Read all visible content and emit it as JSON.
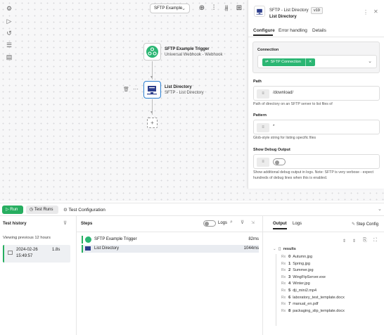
{
  "canvas": {
    "workflow_select": "SFTP Example",
    "node_trigger": {
      "title": "SFTP Example Trigger",
      "subtitle": "Universal Webhook - Webhook"
    },
    "node_list": {
      "title": "List Directory",
      "subtitle": "SFTP - List Directory"
    },
    "add_symbol": "+"
  },
  "panel": {
    "header_title": "SFTP - List Directory",
    "version": "v19",
    "name": "List Directory",
    "tabs": [
      "Configure",
      "Error handling",
      "Details"
    ],
    "connection": {
      "label": "Connection",
      "value": "SFTP Connection"
    },
    "path": {
      "label": "Path",
      "value": "/download/",
      "hint": "Path of directory on an SFTP server to list files of"
    },
    "pattern": {
      "label": "Pattern",
      "value": "*",
      "hint": "Glob-style string for listing specific files"
    },
    "debug": {
      "label": "Show Debug Output",
      "hint": "Show additional debug output in logs. Note: SFTP is very verbose - expect hundreds of debug lines when this is enabled."
    },
    "fx_symbol": "≡"
  },
  "bottom": {
    "run_label": "Run",
    "test_runs_label": "Test Runs",
    "test_config_label": "Test Configuration",
    "history": {
      "title": "Test history",
      "viewing": "Viewing previous 12 hours",
      "run_date": "2024-02-26",
      "run_time": "15:49:57",
      "run_duration": "1.8s"
    },
    "steps": {
      "title": "Steps",
      "logs_label": "Logs",
      "items": [
        {
          "name": "SFTP Example Trigger",
          "duration": "82ms"
        },
        {
          "name": "List Directory",
          "duration": "1044ms"
        }
      ]
    },
    "output": {
      "tabs": [
        "Output",
        "Logs"
      ],
      "step_config": "Step Config",
      "root_count": "[]",
      "root_label": "results",
      "items": [
        {
          "idx": "0",
          "name": "Autumn.jpg"
        },
        {
          "idx": "1",
          "name": "Spring.jpg"
        },
        {
          "idx": "2",
          "name": "Summer.jpg"
        },
        {
          "idx": "3",
          "name": "WingFtpServer.exe"
        },
        {
          "idx": "4",
          "name": "Winter.jpg"
        },
        {
          "idx": "5",
          "name": "dji_mini2.mp4"
        },
        {
          "idx": "6",
          "name": "laboratory_test_template.docx"
        },
        {
          "idx": "7",
          "name": "manual_en.pdf"
        },
        {
          "idx": "8",
          "name": "packaging_slip_template.docx"
        }
      ],
      "type_marker": "Rx"
    }
  },
  "colors": {
    "accent_green": "#27ae60",
    "brand_blue": "#2d3e8c",
    "tag_green": "#2bb673"
  }
}
